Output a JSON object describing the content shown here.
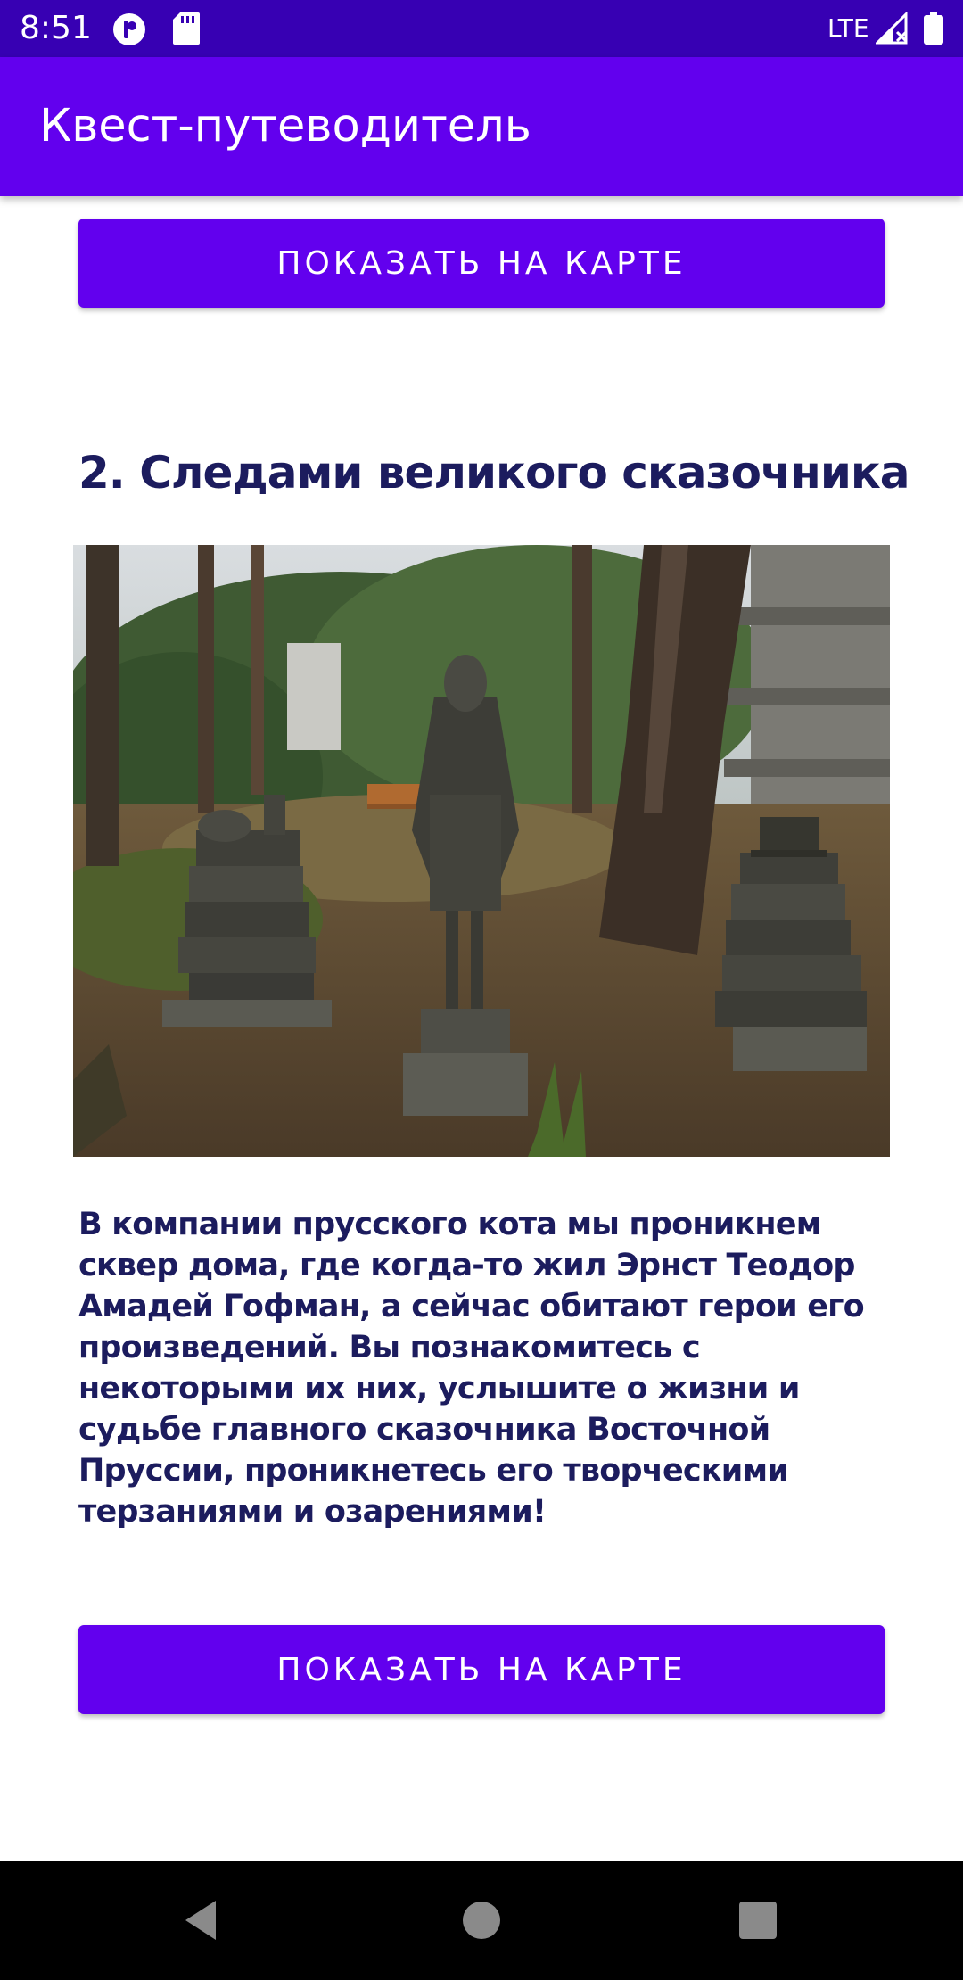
{
  "status_bar": {
    "time": "8:51",
    "network": "LTE",
    "icons": [
      "app-notification-icon",
      "sd-card-icon",
      "signal-icon",
      "battery-icon"
    ]
  },
  "app_bar": {
    "title": "Квест-путеводитель"
  },
  "content": {
    "top_button_label": "ПОКАЗАТЬ НА КАРТЕ",
    "section_title": "2. Следами великого сказочника",
    "image_alt": "Скульптуры в сквере",
    "description": "В компании прусского кота мы проникнем сквер дома, где когда-то жил Эрнст Теодор Амадей Гофман, а сейчас обитают герои его произведений. Вы познакомитесь с некоторыми их них, услышите о жизни и судьбе главного сказочника Восточной Пруссии, проникнетесь его творческими терзаниями и озарениями!",
    "bottom_button_label": "ПОКАЗАТЬ НА КАРТЕ"
  },
  "nav_bar": {
    "icons": [
      "back-icon",
      "home-icon",
      "recents-icon"
    ]
  },
  "colors": {
    "status_bar": "#3700b3",
    "primary": "#6200ee",
    "text_dark": "#1c1c5e"
  }
}
